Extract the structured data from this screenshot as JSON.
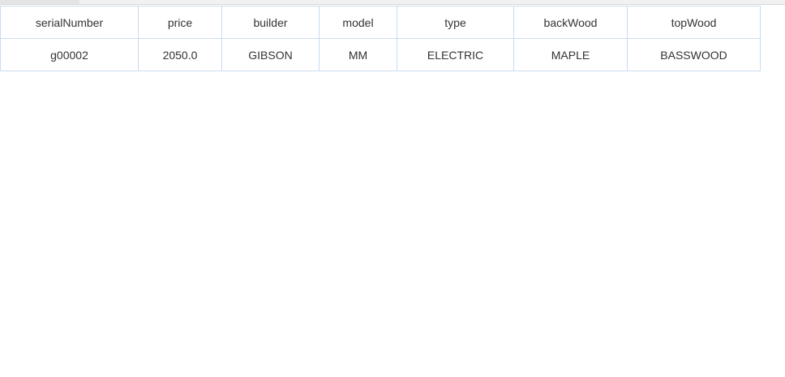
{
  "table": {
    "columns": [
      "serialNumber",
      "price",
      "builder",
      "model",
      "type",
      "backWood",
      "topWood"
    ],
    "rows": [
      [
        "g00002",
        "2050.0",
        "GIBSON",
        "MM",
        "ELECTRIC",
        "MAPLE",
        "BASSWOOD"
      ]
    ]
  },
  "colors": {
    "border": "#c9dcef",
    "text": "#333333",
    "background": "#ffffff"
  }
}
